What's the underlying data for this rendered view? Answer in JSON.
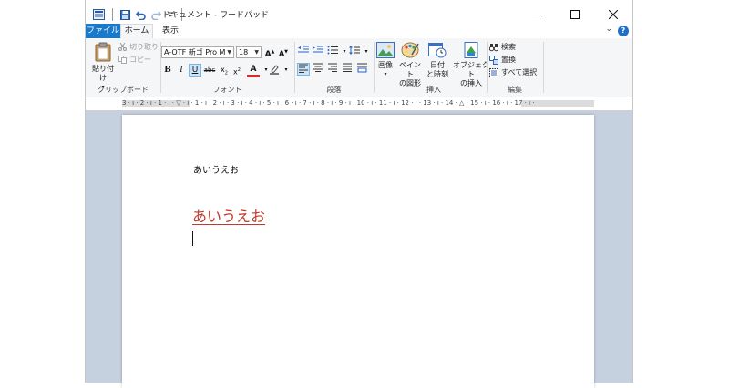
{
  "window": {
    "title": "ドキュメント - ワードパッド"
  },
  "tabs": {
    "file": "ファイル",
    "home": "ホーム",
    "view": "表示"
  },
  "help_label": "?",
  "clipboard": {
    "paste": "貼り付け",
    "cut": "切り取り",
    "copy": "コピー",
    "group": "クリップボード"
  },
  "font": {
    "family": "A-OTF 新ゴ Pro M",
    "size": "18",
    "group": "フォント"
  },
  "paragraph": {
    "group": "段落"
  },
  "insert": {
    "picture": "画像",
    "paint_line1": "ペイント",
    "paint_line2": "の図形",
    "datetime_line1": "日付",
    "datetime_line2": "と時刻",
    "object_line1": "オブジェクト",
    "object_line2": "の挿入",
    "group": "挿入"
  },
  "editing": {
    "find": "検索",
    "replace": "置換",
    "select_all": "すべて選択",
    "group": "編集"
  },
  "ruler": {
    "labels": "3 · ı · 2 · ı · 1 · ı · ▽ · ı · 1 · ı · 2 · ı · 3 · ı · 4 · ı · 5 · ı · 6 · ı · 7 · ı · 8 · ı · 9 · ı · 10 · ı · 11 · ı · 12 · ı · 13 · ı · 14 · △ · 15 · ı · 16 · ı · 17 · ı ·"
  },
  "document": {
    "line1": "あいうえお",
    "line2": "あいうえお",
    "line2_color": "#c0392b"
  },
  "colors": {
    "accent": "#1979ca",
    "ribbon_bg": "#f5f6f7",
    "doc_bg": "#c6d1e0"
  }
}
